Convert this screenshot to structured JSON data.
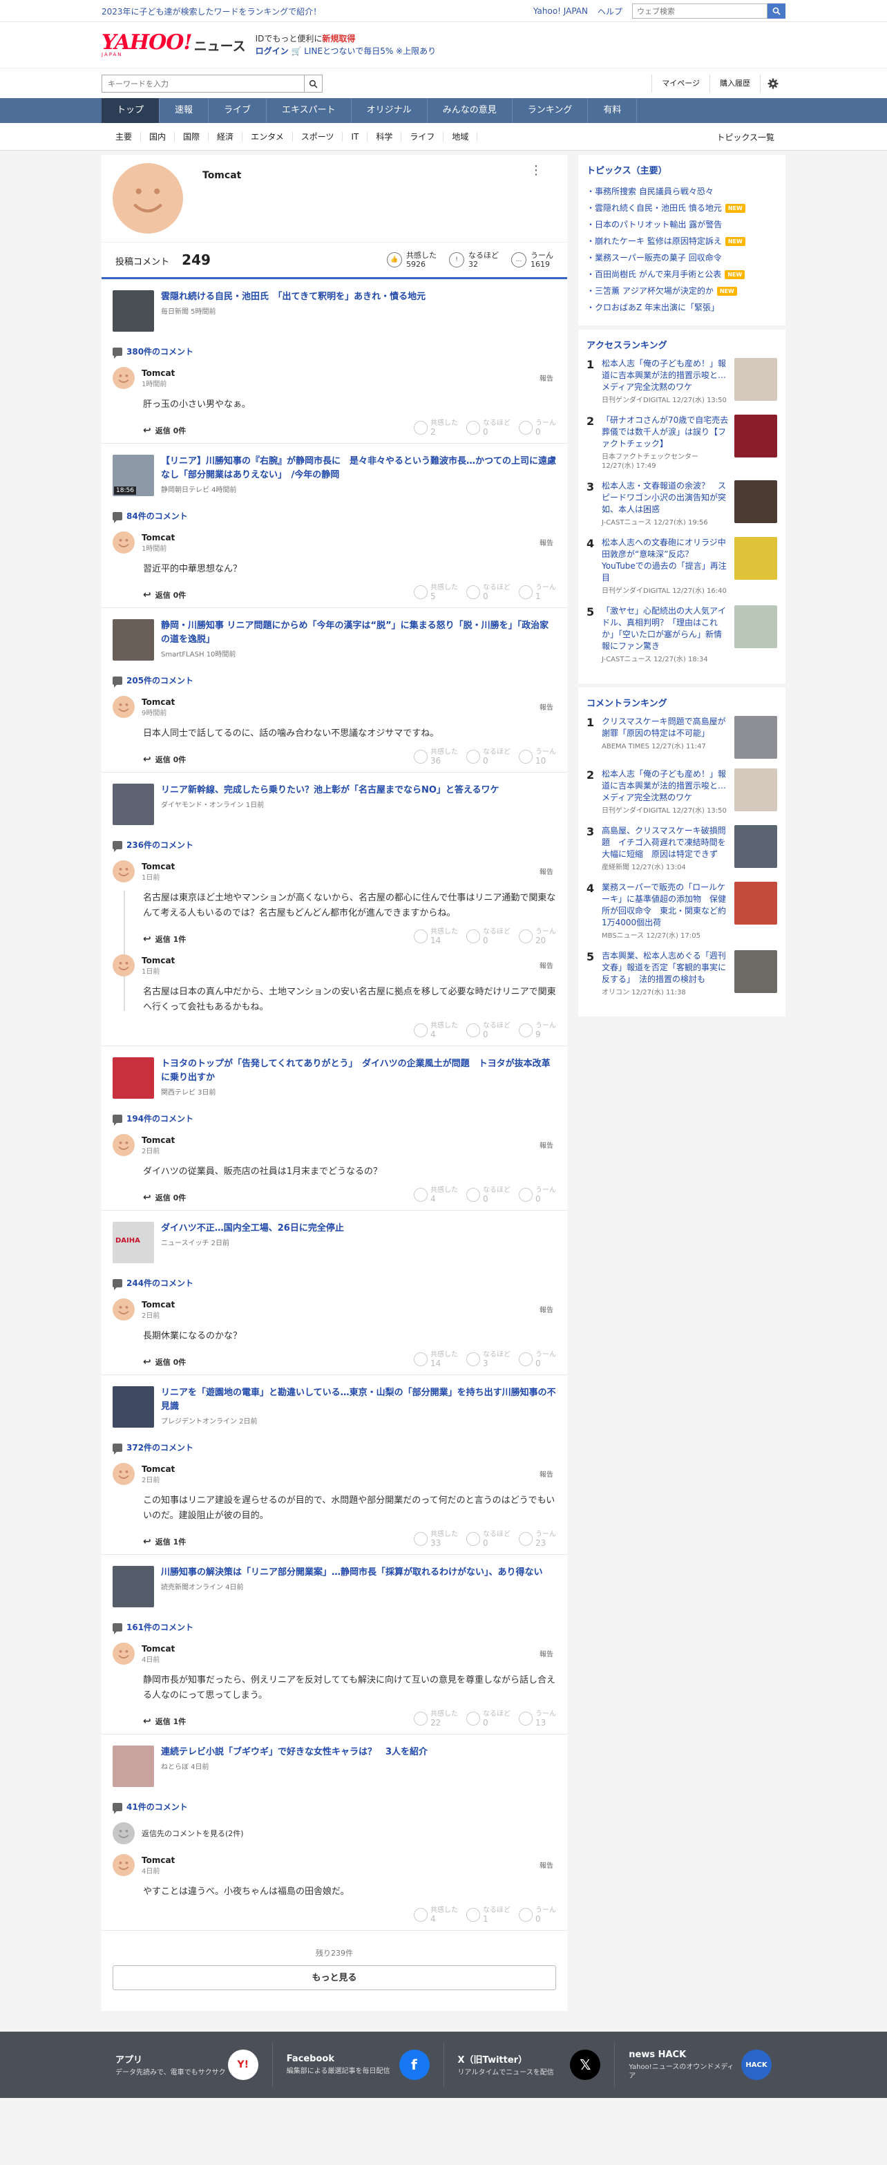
{
  "topstrip": {
    "promo": "2023年に子ども達が検索したワードをランキングで紹介！",
    "yahoo_japan": "Yahoo! JAPAN",
    "help": "ヘルプ",
    "websearch_placeholder": "ウェブ検索"
  },
  "logo": {
    "brand": "YAHOO!",
    "sub": "JAPAN",
    "news": "ニュース"
  },
  "idbox": {
    "line1": "IDでもっと便利に",
    "line1_strong": "新規取得",
    "login": "ログイン",
    "line_promo": "LINEとつないで毎日5% ※上限あり"
  },
  "search": {
    "placeholder": "キーワードを入力"
  },
  "usernav": {
    "mypage": "マイページ",
    "history": "購入履歴"
  },
  "gnav": [
    "トップ",
    "速報",
    "ライブ",
    "エキスパート",
    "オリジナル",
    "みんなの意見",
    "ランキング",
    "有料"
  ],
  "subnav": [
    "主要",
    "国内",
    "国際",
    "経済",
    "エンタメ",
    "スポーツ",
    "IT",
    "科学",
    "ライフ",
    "地域"
  ],
  "subnav_all": "トピックス一覧",
  "profile": {
    "name": "Tomcat",
    "posts_label": "投稿コメント",
    "posts_count": "249",
    "kebab": "⋮",
    "reactions": [
      {
        "label": "共感した",
        "count": "5926",
        "icon": "👍"
      },
      {
        "label": "なるほど",
        "count": "32",
        "icon": "!"
      },
      {
        "label": "うーん",
        "count": "1619",
        "icon": "…"
      }
    ]
  },
  "reply_label": "返信 0件",
  "report_label": "報告",
  "react_labels": [
    "共感した",
    "なるほど",
    "うーん"
  ],
  "articles": [
    {
      "title": "雲隠れ続ける自民・池田氏　「出てきて釈明を」あきれ・憤る地元",
      "source": "毎日新聞 5時間前",
      "comments_label": "380件のコメント",
      "thumb": "#4a4e55",
      "comments": [
        {
          "name": "Tomcat",
          "time": "1時間前",
          "text": "肝っ玉の小さい男やなぁ。",
          "reply": "返信 0件",
          "r": [
            "2",
            "0",
            "0"
          ]
        }
      ]
    },
    {
      "title": "【リニア】川勝知事の『右腕』が静岡市長に　是々非々やるという難波市長…かつての上司に遠慮なし「部分開業はありえない」　/今年の静岡",
      "source": "静岡朝日テレビ 4時間前",
      "comments_label": "84件のコメント",
      "thumb": "#8e99a8",
      "play": "18:56",
      "comments": [
        {
          "name": "Tomcat",
          "time": "1時間前",
          "text": "習近平的中華思想なん？",
          "reply": "返信 0件",
          "r": [
            "5",
            "0",
            "1"
          ]
        }
      ]
    },
    {
      "title": "静岡・川勝知事 リニア問題にからめ「今年の漢字は“脱”」に集まる怒り「脱・川勝を」「政治家の道を逸脱」",
      "source": "SmartFLASH 10時間前",
      "comments_label": "205件のコメント",
      "thumb": "#6a5f58",
      "comments": [
        {
          "name": "Tomcat",
          "time": "9時間前",
          "text": "日本人同士で話してるのに、話の噛み合わない不思議なオジサマですね。",
          "reply": "返信 0件",
          "r": [
            "36",
            "0",
            "10"
          ]
        }
      ]
    },
    {
      "title": "リニア新幹線、完成したら乗りたい？池上彰が「名古屋までならNO」と答えるワケ",
      "source": "ダイヤモンド・オンライン 1日前",
      "comments_label": "236件のコメント",
      "thumb": "#5d6270",
      "comments": [
        {
          "name": "Tomcat",
          "time": "1日前",
          "text": "名古屋は東京ほど土地やマンションが高くないから、名古屋の都心に住んで仕事はリニア通勤で関東なんて考える人もいるのでは？名古屋もどんどん都市化が進んできますからね。",
          "reply": "返信 1件",
          "r": [
            "14",
            "0",
            "20"
          ]
        },
        {
          "name": "Tomcat",
          "time": "1日前",
          "text": "名古屋は日本の真ん中だから、土地マンションの安い名古屋に拠点を移して必要な時だけリニアで関東へ行くって会社もあるかもね。",
          "reply": "",
          "r": [
            "4",
            "0",
            "9"
          ]
        }
      ]
    },
    {
      "title": "トヨタのトップが「告発してくれてありがとう」　ダイハツの企業風土が問題　トヨタが抜本改革に乗り出すか",
      "source": "関西テレビ 3日前",
      "comments_label": "194件のコメント",
      "thumb": "#c8303e",
      "comments": [
        {
          "name": "Tomcat",
          "time": "2日前",
          "text": "ダイハツの従業員、販売店の社員は1月末までどうなるの？",
          "reply": "返信 0件",
          "r": [
            "4",
            "0",
            "0"
          ]
        }
      ]
    },
    {
      "title": "ダイハツ不正…国内全工場、26日に完全停止",
      "source": "ニュースイッチ 2日前",
      "comments_label": "244件のコメント",
      "thumb": "#d9d9d9",
      "thumb_label": "DAIHA",
      "comments": [
        {
          "name": "Tomcat",
          "time": "2日前",
          "text": "長期休業になるのかな？",
          "reply": "返信 0件",
          "r": [
            "14",
            "3",
            "0"
          ]
        }
      ]
    },
    {
      "title": "リニアを「遊園地の電車」と勘違いしている…東京・山梨の「部分開業」を持ち出す川勝知事の不見識",
      "source": "プレジデントオンライン 2日前",
      "comments_label": "372件のコメント",
      "thumb": "#3f4a62",
      "comments": [
        {
          "name": "Tomcat",
          "time": "2日前",
          "text": "この知事はリニア建設を遅らせるのが目的で、水問題や部分開業だのって何だのと言うのはどうでもいいのだ。建設阻止が彼の目的。",
          "reply": "返信 1件",
          "r": [
            "33",
            "0",
            "23"
          ]
        }
      ]
    },
    {
      "title": "川勝知事の解決策は「リニア部分開業案」…静岡市長「採算が取れるわけがない」、あり得ない",
      "source": "読売新聞オンライン 4日前",
      "comments_label": "161件のコメント",
      "thumb": "#555d6a",
      "comments": [
        {
          "name": "Tomcat",
          "time": "4日前",
          "text": "静岡市長が知事だったら、例えリニアを反対してても解決に向けて互いの意見を尊重しながら話し合える人なのにって思ってしまう。",
          "reply": "返信 1件",
          "r": [
            "22",
            "0",
            "13"
          ]
        }
      ]
    },
    {
      "title": "連続テレビ小説「ブギウギ」で好きな女性キャラは？　3人を紹介",
      "source": "ねとらぼ 4日前",
      "comments_label": "41件のコメント",
      "thumb": "#c9a2a0",
      "see_parent": "返信先のコメントを見る(2件)",
      "comments": [
        {
          "name": "Tomcat",
          "time": "4日前",
          "text": "やすことは違うべ。小夜ちゃんは福島の田舎娘だ。",
          "reply": "",
          "r": [
            "4",
            "1",
            "0"
          ]
        }
      ]
    }
  ],
  "more": {
    "remain": "残り239件",
    "button": "もっと見る"
  },
  "topics": {
    "title": "トピックス（主要）",
    "items": [
      {
        "t": "事務所捜索 自民議員ら戦々恐々",
        "new": false
      },
      {
        "t": "雲隠れ続く自民・池田氏 憤る地元",
        "new": true
      },
      {
        "t": "日本のパトリオット輸出 露が警告",
        "new": false
      },
      {
        "t": "崩れたケーキ 監修は原因特定訴え",
        "new": true
      },
      {
        "t": "業務スーパー販売の菓子 回収命令",
        "new": false
      },
      {
        "t": "百田尚樹氏 がんで来月手術と公表",
        "new": true
      },
      {
        "t": "三笘薫 アジア杯欠場が決定的か",
        "new": true
      },
      {
        "t": "クロおばあZ 年末出演に「緊張」",
        "new": false
      }
    ],
    "new_label": "NEW"
  },
  "access_ranking": {
    "title": "アクセスランキング",
    "items": [
      {
        "n": "1",
        "t": "松本人志「俺の子ども産め！」報道に吉本興業が法的措置示唆と…メディア完全沈黙のワケ",
        "s": "日刊ゲンダイDIGITAL 12/27(水) 13:50",
        "c": "#d5c8bd"
      },
      {
        "n": "2",
        "t": "「研ナオコさんが70歳で自宅売去 葬儀では数千人が涙」は誤り【ファクトチェック】",
        "s": "日本ファクトチェックセンター 12/27(水) 17:49",
        "c": "#8b1d2a"
      },
      {
        "n": "3",
        "t": "松本人志・文春報道の余波？　スピードワゴン小沢の出演告知が突如、本人は困惑",
        "s": "J-CASTニュース 12/27(水) 19:56",
        "c": "#4b3c33"
      },
      {
        "n": "4",
        "t": "松本人志への文春砲にオリラジ中田敦彦が“意味深”反応？ YouTubeでの過去の「提言」再注目",
        "s": "日刊ゲンダイDIGITAL 12/27(水) 16:40",
        "c": "#e0c238"
      },
      {
        "n": "5",
        "t": "「激ヤセ」心配続出の大人気アイドル、真相判明？「理由はこれか」「空いた口が塞がらん」新情報にファン驚き",
        "s": "J-CASTニュース 12/27(水) 18:34",
        "c": "#b9c7b8"
      }
    ]
  },
  "comment_ranking": {
    "title": "コメントランキング",
    "items": [
      {
        "n": "1",
        "t": "クリスマスケーキ問題で高島屋が謝罪「原因の特定は不可能」",
        "s": "ABEMA TIMES 12/27(水) 11:47",
        "c": "#8d8f94"
      },
      {
        "n": "2",
        "t": "松本人志「俺の子ども産め！」報道に吉本興業が法的措置示唆と…メディア完全沈黙のワケ",
        "s": "日刊ゲンダイDIGITAL 12/27(水) 13:50",
        "c": "#d5c8bd"
      },
      {
        "n": "3",
        "t": "高島屋、クリスマスケーキ破損問題　イチゴ入荷遅れで凍結時間を大幅に短縮　原因は特定できず",
        "s": "産経新聞 12/27(水) 13:04",
        "c": "#5a6470"
      },
      {
        "n": "4",
        "t": "業務スーパーで販売の「ロールケーキ」に基準値超の添加物　保健所が回収命令　東北・関東など約1万4000個出荷",
        "s": "MBSニュース 12/27(水) 17:05",
        "c": "#c44b3c"
      },
      {
        "n": "5",
        "t": "吉本興業、松本人志めぐる「週刊文春」報道を否定「客観的事実に反する」　法的措置の検討も",
        "s": "オリコン 12/27(水) 11:38",
        "c": "#6e6a66"
      }
    ]
  },
  "footer": [
    {
      "h": "アプリ",
      "d": "データ先読みで、電車でもサクサク",
      "icon": "Y!",
      "color": "#ffffff"
    },
    {
      "h": "Facebook",
      "d": "編集部による厳選記事を毎日配信",
      "icon": "f",
      "color": "#1877f2"
    },
    {
      "h": "X（旧Twitter）",
      "d": "リアルタイムでニュースを配信",
      "icon": "𝕏",
      "color": "#000000"
    },
    {
      "h": "news HACK",
      "d": "Yahoo!ニュースのオウンドメディア",
      "icon": "HACK",
      "color": "#2a66c8"
    }
  ]
}
